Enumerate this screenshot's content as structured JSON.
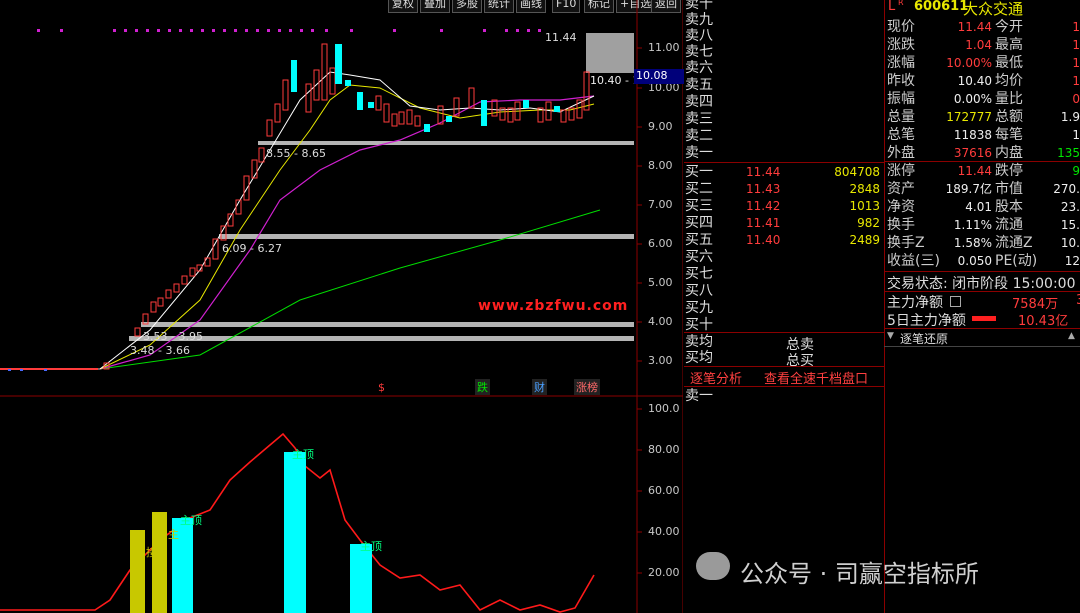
{
  "toolbar": {
    "buttons": [
      "复权",
      "叠加",
      "多股",
      "统计",
      "画线",
      "F10",
      "标记",
      "+自选",
      "返回"
    ]
  },
  "main_chart": {
    "price_labels": [
      "11.00",
      "10.00",
      "9.00",
      "8.00",
      "7.00",
      "6.00",
      "5.00",
      "4.00",
      "3.00"
    ],
    "high_label": "11.44",
    "right_label": "10.40 - 1",
    "current_price_tag": "10.08",
    "zone_labels": [
      "8.55 - 8.65",
      "6.09 - 6.27",
      "3.53 - 3.95",
      "3.48 - 3.66"
    ],
    "markers": [
      "$",
      "跌",
      "财",
      "涨榜"
    ],
    "watermark": "www.zbzfwu.com"
  },
  "sub_chart": {
    "labels": [
      "100.0",
      "80.00",
      "60.00",
      "40.00",
      "20.00"
    ],
    "bar_labels": [
      "接",
      "主",
      "主顶",
      "主顶",
      "主顶"
    ]
  },
  "order_book": {
    "sell_labels": [
      "卖十",
      "卖九",
      "卖八",
      "卖七",
      "卖六",
      "卖五",
      "卖四",
      "卖三",
      "卖二",
      "卖一"
    ],
    "buy_rows": [
      {
        "label": "买一",
        "price": "11.44",
        "vol": "804708"
      },
      {
        "label": "买二",
        "price": "11.43",
        "vol": "2848"
      },
      {
        "label": "买三",
        "price": "11.42",
        "vol": "1013"
      },
      {
        "label": "买四",
        "price": "11.41",
        "vol": "982"
      },
      {
        "label": "买五",
        "price": "11.40",
        "vol": "2489"
      },
      {
        "label": "买六",
        "price": "",
        "vol": ""
      },
      {
        "label": "买七",
        "price": "",
        "vol": ""
      },
      {
        "label": "买八",
        "price": "",
        "vol": ""
      },
      {
        "label": "买九",
        "price": "",
        "vol": ""
      },
      {
        "label": "买十",
        "price": "",
        "vol": ""
      }
    ],
    "avg_sell": "卖均",
    "avg_buy": "买均",
    "total_sell": "总卖",
    "total_buy": "总买",
    "tab_tick": "逐笔分析",
    "tab_full": "查看全速千档盘口",
    "tick_first": "卖一"
  },
  "quote": {
    "badge": "L",
    "badge2": "R",
    "code": "600611",
    "name": "大众交通",
    "rows": [
      {
        "l1": "现价",
        "v1": "11.44",
        "l2": "今开",
        "v2": "1"
      },
      {
        "l1": "涨跌",
        "v1": "1.04",
        "l2": "最高",
        "v2": "1"
      },
      {
        "l1": "涨幅",
        "v1": "10.00%",
        "l2": "最低",
        "v2": "1"
      },
      {
        "l1": "昨收",
        "v1": "10.40",
        "l2": "均价",
        "v2": "1"
      },
      {
        "l1": "振幅",
        "v1": "0.00%",
        "l2": "量比",
        "v2": "0"
      },
      {
        "l1": "总量",
        "v1": "172777",
        "l2": "总额",
        "v2": "1.9"
      },
      {
        "l1": "总笔",
        "v1": "11838",
        "l2": "每笔",
        "v2": "1"
      },
      {
        "l1": "外盘",
        "v1": "37616",
        "l2": "内盘",
        "v2": "135"
      },
      {
        "l1": "涨停",
        "v1": "11.44",
        "l2": "跌停",
        "v2": "9"
      },
      {
        "l1": "资产",
        "v1": "189.7亿",
        "l2": "市值",
        "v2": "270."
      },
      {
        "l1": "净资",
        "v1": "4.01",
        "l2": "股本",
        "v2": "23."
      },
      {
        "l1": "换手",
        "v1": "1.11%",
        "l2": "流通",
        "v2": "15."
      },
      {
        "l1": "换手Z",
        "v1": "1.58%",
        "l2": "流通Z",
        "v2": "10."
      },
      {
        "l1": "收益(三)",
        "v1": "0.050",
        "l2": "PE(动)",
        "v2": "12"
      }
    ],
    "trade_status": "交易状态: 闭市阶段 15:00:00",
    "main_net_label": "主力净额",
    "main_net_value": "7584万",
    "main_net_extra": "3",
    "five_day_label": "5日主力净额",
    "five_day_value": "10.43亿",
    "tick_restore": "逐笔还原"
  },
  "footer_watermark": "公众号 · 司赢空指标所",
  "colors": {
    "up": "#ff3c3c",
    "cyan": "#00ffff",
    "olive": "#c8c800",
    "ma5": "#ffffff",
    "ma10": "#e8e800",
    "ma20": "#d020d0",
    "ma60": "#00dd00"
  }
}
